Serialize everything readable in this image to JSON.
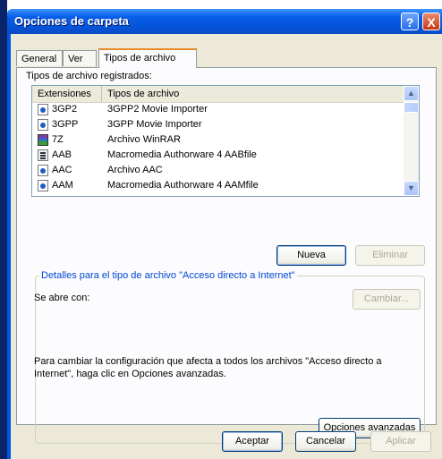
{
  "window": {
    "title": "Opciones de carpeta"
  },
  "tabs": [
    "General",
    "Ver",
    "Tipos de archivo"
  ],
  "registered_label": "Tipos de archivo registrados:",
  "list": {
    "columns": [
      "Extensiones",
      "Tipos de archivo"
    ],
    "rows": [
      {
        "ext": "3GP2",
        "type": "3GPP2 Movie Importer",
        "icon": "quicktime-icon"
      },
      {
        "ext": "3GPP",
        "type": "3GPP Movie Importer",
        "icon": "quicktime-icon"
      },
      {
        "ext": "7Z",
        "type": "Archivo WinRAR",
        "icon": "winrar-icon"
      },
      {
        "ext": "AAB",
        "type": "Macromedia Authorware 4 AABfile",
        "icon": "authorware-icon"
      },
      {
        "ext": "AAC",
        "type": "Archivo AAC",
        "icon": "quicktime-icon"
      },
      {
        "ext": "AAM",
        "type": "Macromedia Authorware 4 AAMfile",
        "icon": "quicktime-icon"
      }
    ]
  },
  "buttons": {
    "new": "Nueva",
    "delete": "Eliminar",
    "change": "Cambiar...",
    "advanced": "Opciones avanzadas",
    "ok": "Aceptar",
    "cancel": "Cancelar",
    "apply": "Aplicar"
  },
  "details": {
    "legend": "Detalles para el tipo de archivo \"Acceso directo a Internet\"",
    "opens_with": "Se abre con:",
    "info": "Para cambiar la configuración que afecta a todos los archivos \"Acceso directo a Internet\", haga clic en Opciones avanzadas."
  },
  "titlebar_buttons": {
    "help": "?",
    "close": "X"
  }
}
